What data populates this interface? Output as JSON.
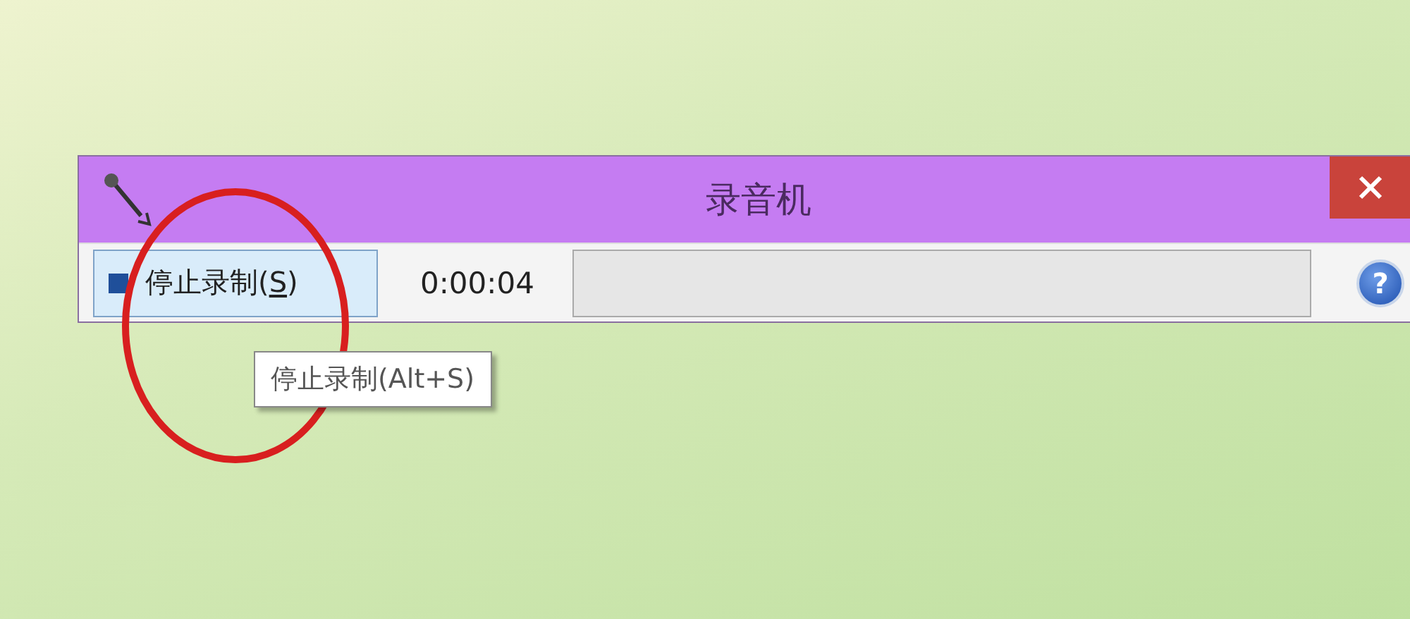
{
  "window": {
    "title": "录音机"
  },
  "toolbar": {
    "record_button": {
      "label_before": "停止录制(",
      "access_key": "S",
      "label_after": ")",
      "hovered": true
    },
    "elapsed": "0:00:04",
    "help": "?"
  },
  "tooltip": {
    "text": "停止录制(Alt+S)"
  }
}
